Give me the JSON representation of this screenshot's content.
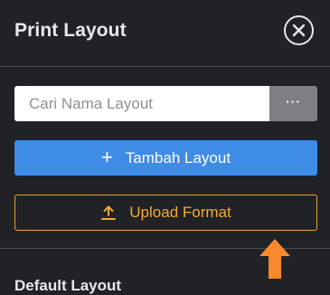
{
  "header": {
    "title": "Print Layout"
  },
  "search": {
    "placeholder": "Cari Nama Layout",
    "more_label": "···"
  },
  "actions": {
    "add_label": "Tambah Layout",
    "add_icon": "plus-icon",
    "upload_label": "Upload Format",
    "upload_icon": "upload-icon"
  },
  "section": {
    "title": "Default Layout"
  },
  "colors": {
    "background": "#202226",
    "primary": "#3f8ce6",
    "accent": "#f2aa33",
    "arrow": "#f7892b"
  }
}
